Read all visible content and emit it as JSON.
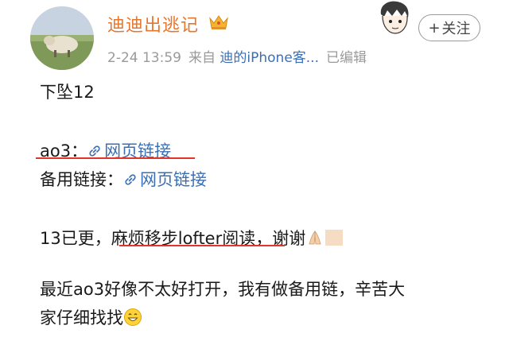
{
  "post": {
    "author": "迪迪出逃记",
    "time": "2-24 13:59",
    "source_prefix": "来自",
    "source": "迪的iPhone客...",
    "edited": "已编辑",
    "follow_label": "关注",
    "follow_prefix": "+"
  },
  "content": {
    "line1": "下坠12",
    "ao3_label": "ao3：",
    "ao3_link": "网页链接",
    "backup_label": "备用链接：",
    "backup_link": "网页链接",
    "line4_a": "13已更，",
    "line4_b": "麻烦移步lofter阅读",
    "line4_c": "，谢谢",
    "line5": "最近ao3好像不太好打开，我有做备用链，辛苦大",
    "line6": "家仔细找找"
  },
  "colors": {
    "author": "#e8752c",
    "link": "#3a6fb5",
    "meta": "#9a9a9a",
    "underline": "#e0352b"
  }
}
